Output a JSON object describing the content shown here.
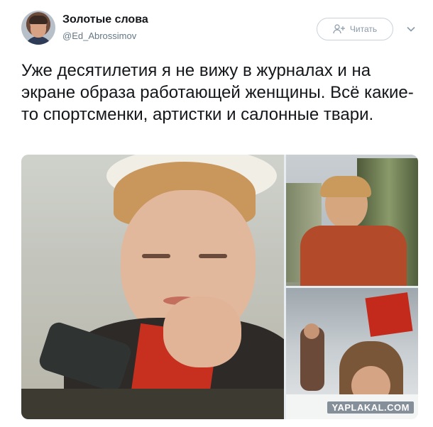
{
  "author": {
    "display_name": "Золотые слова",
    "username": "@Ed_Abrossimov"
  },
  "actions": {
    "follow_label": "Читать"
  },
  "tweet": {
    "text": "Уже десятилетия я не вижу в журналах и на экране образа работающей женщины. Всё какие-то спортсменки, артистки и салонные твари."
  },
  "media": {
    "watermark": "YAPLAKAL.COM"
  },
  "colors": {
    "text_primary": "#14171a",
    "text_secondary": "#657786",
    "border": "#c9d2da"
  },
  "icons": {
    "follow": "person-plus-icon",
    "menu": "chevron-down-icon"
  }
}
